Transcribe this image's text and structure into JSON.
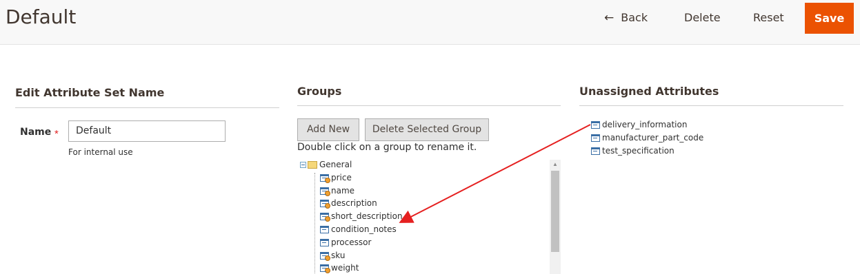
{
  "header": {
    "title": "Default",
    "back_label": "Back",
    "delete_label": "Delete",
    "reset_label": "Reset",
    "save_label": "Save"
  },
  "name_section": {
    "title": "Edit Attribute Set Name",
    "name_label": "Name",
    "required_mark": "*",
    "name_value": "Default",
    "help_text": "For internal use"
  },
  "groups": {
    "title": "Groups",
    "add_new_label": "Add New",
    "delete_group_label": "Delete Selected Group",
    "hint": "Double click on a group to rename it.",
    "tree": {
      "group_name": "General",
      "items": [
        {
          "label": "price",
          "system": true
        },
        {
          "label": "name",
          "system": true
        },
        {
          "label": "description",
          "system": true
        },
        {
          "label": "short_description",
          "system": true
        },
        {
          "label": "condition_notes",
          "system": false
        },
        {
          "label": "processor",
          "system": false
        },
        {
          "label": "sku",
          "system": true
        },
        {
          "label": "weight",
          "system": true
        }
      ]
    }
  },
  "unassigned": {
    "title": "Unassigned Attributes",
    "items": [
      {
        "label": "delivery_information"
      },
      {
        "label": "manufacturer_part_code"
      },
      {
        "label": "test_specification"
      }
    ]
  },
  "colors": {
    "accent": "#eb5202",
    "arrow": "#e52020"
  }
}
